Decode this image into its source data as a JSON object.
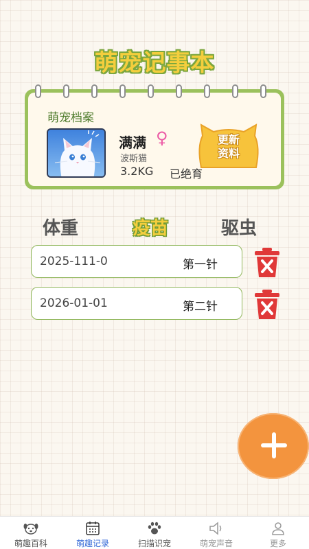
{
  "app": {
    "title": "萌宠记事本"
  },
  "profile": {
    "heading": "萌宠档案",
    "name": "满满",
    "gender_symbol": "♀",
    "breed": "波斯猫",
    "weight": "3.2KG",
    "status": "已绝育",
    "update_label": "更新\n资料"
  },
  "tabs": [
    {
      "label": "体重",
      "active": false
    },
    {
      "label": "疫苗",
      "active": true
    },
    {
      "label": "驱虫",
      "active": false
    }
  ],
  "records": [
    {
      "date": "2025-111-0",
      "dose": "第一针"
    },
    {
      "date": "2026-01-01",
      "dose": "第二针"
    }
  ],
  "nav": [
    {
      "label": "萌趣百科",
      "icon": "dog-face-icon",
      "active": false
    },
    {
      "label": "萌趣记录",
      "icon": "calendar-icon",
      "active": true
    },
    {
      "label": "扫描识宠",
      "icon": "paw-icon",
      "active": false
    },
    {
      "label": "萌宠声音",
      "icon": "speaker-icon",
      "active": false
    },
    {
      "label": "更多",
      "icon": "person-icon",
      "active": false
    }
  ],
  "colors": {
    "accent_green": "#9bc15c",
    "title_yellow": "#f4ce3d",
    "fab_orange": "#f3943e",
    "delete_red": "#e03838",
    "nav_active": "#3b6ed8"
  }
}
